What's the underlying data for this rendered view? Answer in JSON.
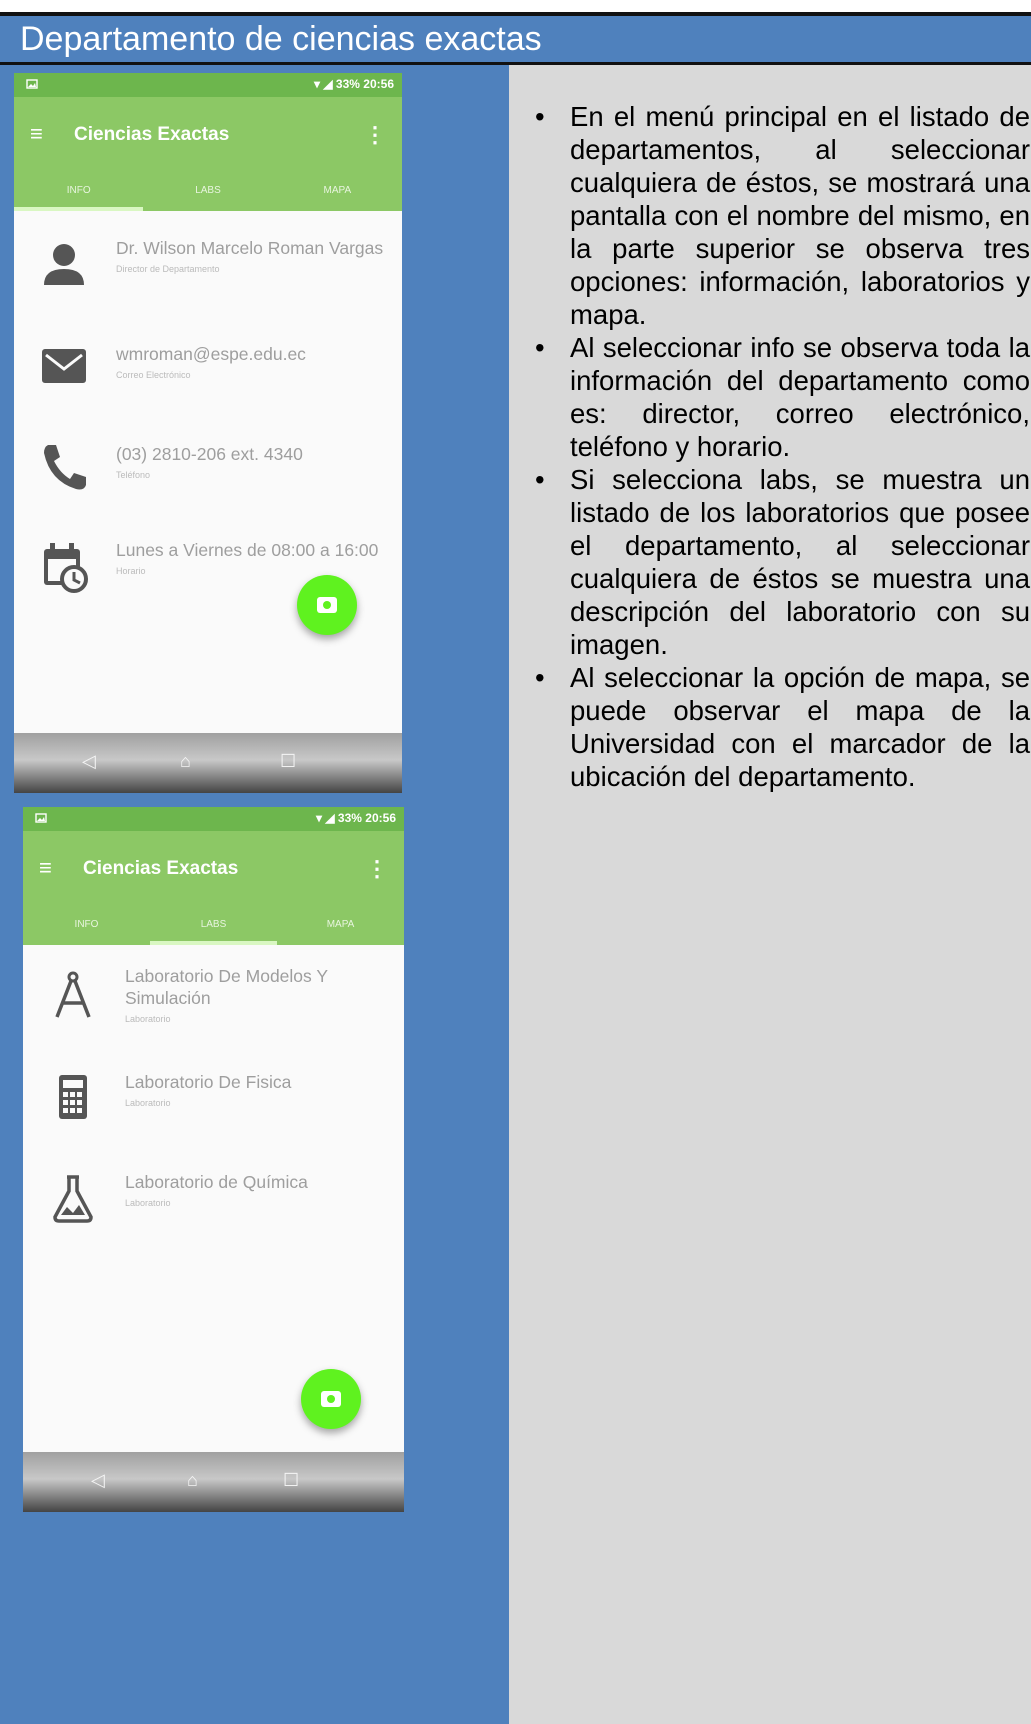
{
  "header": {
    "title": "Departamento de ciencias exactas"
  },
  "colors": {
    "header_bg": "#4f81bd",
    "right_bg": "#d9d9d9",
    "app_green": "#8cc865",
    "fab_green": "#5ff21f"
  },
  "phone1": {
    "status_time": "20:56",
    "status_battery": "33%",
    "app_title": "Ciencias Exactas",
    "tabs": [
      "INFO",
      "LABS",
      "MAPA"
    ],
    "active_tab": "INFO",
    "items": [
      {
        "icon": "person-icon",
        "title": "Dr. Wilson Marcelo Roman Vargas",
        "subtitle": "Director de Departamento"
      },
      {
        "icon": "mail-icon",
        "title": "wmroman@espe.edu.ec",
        "subtitle": "Correo Electrónico"
      },
      {
        "icon": "phone-icon",
        "title": "(03) 2810-206 ext. 4340",
        "subtitle": "Teléfono"
      },
      {
        "icon": "calendar-clock-icon",
        "title": "Lunes a Viernes de 08:00 a 16:00",
        "subtitle": "Horario"
      }
    ]
  },
  "phone2": {
    "status_time": "20:56",
    "status_battery": "33%",
    "app_title": "Ciencias Exactas",
    "tabs": [
      "INFO",
      "LABS",
      "MAPA"
    ],
    "active_tab": "LABS",
    "items": [
      {
        "icon": "compass-icon",
        "title": "Laboratorio De Modelos Y Simulación",
        "subtitle": "Laboratorio"
      },
      {
        "icon": "calculator-icon",
        "title": "Laboratorio De Fisica",
        "subtitle": "Laboratorio"
      },
      {
        "icon": "flask-icon",
        "title": "Laboratorio de Química",
        "subtitle": "Laboratorio"
      }
    ]
  },
  "bullets": [
    "En el menú principal en el listado de departamentos, al seleccionar cualquiera de éstos, se mostrará una pantalla con el nombre del mismo, en la parte superior se observa tres opciones: información, laboratorios y mapa.",
    "Al seleccionar info se observa toda la información del departamento como es: director, correo electrónico, teléfono y horario.",
    "Si selecciona labs, se muestra un listado de los laboratorios que posee el departamento, al seleccionar cualquiera de éstos se muestra una descripción del laboratorio con su imagen.",
    "Al seleccionar la opción de mapa, se puede observar el mapa de la Universidad con el marcador de la ubicación del departamento."
  ]
}
